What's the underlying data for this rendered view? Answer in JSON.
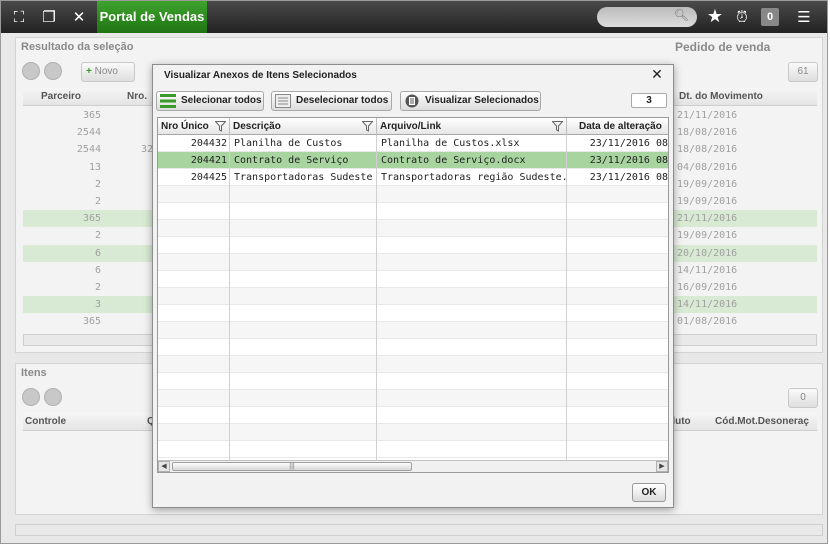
{
  "topbar": {
    "app_tab": "Portal de Vendas",
    "notification_count": "0"
  },
  "background": {
    "selection_panel_title": "Resultado da seleção",
    "context_title": "Pedido de venda",
    "new_button": "Novo",
    "page_count": "61",
    "columns": [
      "Parceiro",
      "Nro.",
      "Dt. do Movimento"
    ],
    "rows": [
      {
        "parceiro": "365",
        "nro": "",
        "date": "21/11/2016",
        "sel": false
      },
      {
        "parceiro": "2544",
        "nro": "",
        "date": "18/08/2016",
        "sel": false
      },
      {
        "parceiro": "2544",
        "nro": "32",
        "date": "18/08/2016",
        "sel": false
      },
      {
        "parceiro": "13",
        "nro": "",
        "date": "04/08/2016",
        "sel": false
      },
      {
        "parceiro": "2",
        "nro": "",
        "date": "19/09/2016",
        "sel": false
      },
      {
        "parceiro": "2",
        "nro": "",
        "date": "19/09/2016",
        "sel": false
      },
      {
        "parceiro": "365",
        "nro": "",
        "date": "21/11/2016",
        "sel": true
      },
      {
        "parceiro": "2",
        "nro": "",
        "date": "19/09/2016",
        "sel": false
      },
      {
        "parceiro": "6",
        "nro": "",
        "date": "20/10/2016",
        "sel": true
      },
      {
        "parceiro": "6",
        "nro": "",
        "date": "14/11/2016",
        "sel": false
      },
      {
        "parceiro": "2",
        "nro": "",
        "date": "16/09/2016",
        "sel": false
      },
      {
        "parceiro": "3",
        "nro": "",
        "date": "14/11/2016",
        "sel": true
      },
      {
        "parceiro": "365",
        "nro": "",
        "date": "01/08/2016",
        "sel": false
      }
    ],
    "items_panel_title": "Itens",
    "items_count": "0",
    "items_columns": [
      "Controle",
      "Q",
      "duto",
      "Cód.Mot.Desoneraç"
    ]
  },
  "modal": {
    "title": "Visualizar Anexos de Itens Selecionados",
    "select_all": "Selecionar todos",
    "deselect_all": "Deselecionar todos",
    "view_selected": "Visualizar Selecionados",
    "count": "3",
    "columns": [
      "Nro Único",
      "Descrição",
      "Arquivo/Link",
      "Data de alteração"
    ],
    "rows": [
      {
        "nro": "204432",
        "desc": "Planilha de Custos",
        "file": "Planilha de Custos.xlsx",
        "date": "23/11/2016 08"
      },
      {
        "nro": "204421",
        "desc": "Contrato de Serviço",
        "file": "Contrato de Serviço.docx",
        "date": "23/11/2016 08"
      },
      {
        "nro": "204425",
        "desc": "Transportadoras Sudeste",
        "file": "Transportadoras região Sudeste.docx",
        "date": "23/11/2016 08"
      }
    ],
    "selected_row": 1,
    "ok": "OK"
  },
  "colors": {
    "accent_green": "#2e8b1e",
    "selected_row": "#a8d4a0"
  }
}
